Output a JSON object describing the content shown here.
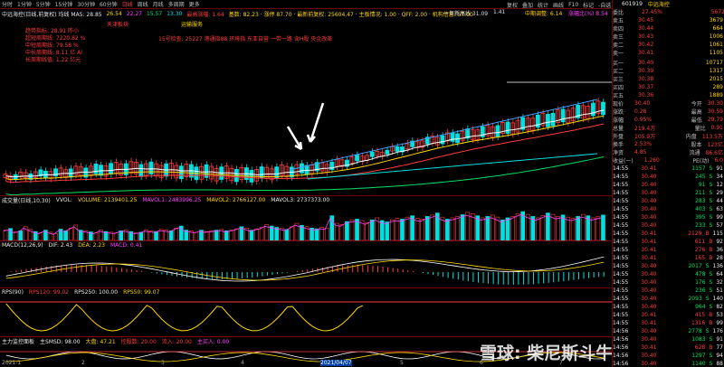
{
  "toolbar": {
    "periods": [
      "分时",
      "1分钟",
      "5分钟",
      "15分钟",
      "30分钟",
      "60分钟",
      "日线",
      "周线",
      "月线",
      "多周期",
      "更多"
    ],
    "selected": "日线",
    "right_items": [
      "复权",
      "叠加",
      "统计",
      "画线",
      "F10",
      "标记",
      "-自选",
      "返回"
    ],
    "stock_code": "601919",
    "stock_name": "中远海控"
  },
  "infoline": {
    "left": "中远海控(日线,前复权) 均线 MA5: 28.85",
    "ma10": "26.54",
    "ma20": "22.27",
    "ma30": "15.57",
    "ma60": "13.30",
    "pe_label": "最高涨幅: 1.64",
    "extra": "基数: 82.23 · 涨停 87.70 · 最新前复权: 25604.47 · 主板情况: 1.00 · QFF: 2.00 · 机构信息: 57.00",
    "anno_top": "一年新高线 31.09",
    "anno_val": "1.41",
    "anno_mid": "中期调整: 6.14",
    "anno_pct": "涨幅比(%) 8.54"
  },
  "chart_labels": {
    "label_a": "天津板块",
    "label_b": "运输服务",
    "legend_lines": [
      "趋势指标: 28.91 昨小",
      "超短周期线: 7220.82 %",
      "中短周期线: 79.58 %",
      "中长周期线: 8.11 亿 Al",
      "长周期线值: 1.22 亿元"
    ],
    "event_text": "15号检查: 25227 港通指88 环境指 东亚自营 一带一路 含H股 央企改革",
    "price_high": "31.09",
    "price_low": "6.59",
    "price_hi2": "22.95",
    "price_hi3": "6.143"
  },
  "price_axis": [
    "30.00",
    "28.00",
    "26.00",
    "24.00",
    "22.00",
    "20.00",
    "18.00",
    "16.00",
    "14.00",
    "12.00",
    "10.00"
  ],
  "volume_panel": {
    "title": "成交量(日线,10,30)",
    "vvol": "VVOL: ",
    "volume": "VOLUME: 2139401.25",
    "mavol1": "MAVOL1: 2483996.25",
    "mavol2": "MAVOL2: 2766127.00",
    "mavol3": "MAVOL3: 2737373.00",
    "axis": [
      "60000",
      "40000",
      "20000"
    ],
    "values": [
      0.3,
      0.35,
      0.25,
      0.28,
      0.4,
      0.32,
      0.26,
      0.22,
      0.3,
      0.24,
      0.2,
      0.33,
      0.28,
      0.36,
      0.45,
      0.3,
      0.28,
      0.25,
      0.22,
      0.3,
      0.26,
      0.24,
      0.22,
      0.28,
      0.3,
      0.26,
      0.22,
      0.24,
      0.3,
      0.28,
      0.26,
      0.32,
      0.3,
      0.28,
      0.36,
      0.42,
      0.3,
      0.28,
      0.24,
      0.3,
      0.26,
      0.28,
      0.3,
      0.32,
      0.28,
      0.3,
      0.34,
      0.4,
      0.36,
      0.3,
      0.34,
      0.38,
      0.46,
      0.42,
      0.38,
      0.36,
      0.32,
      0.4,
      0.5,
      0.44,
      0.4,
      0.36,
      0.34,
      0.38,
      0.36,
      0.72,
      0.5,
      0.46,
      0.55,
      0.6,
      0.62,
      0.58,
      0.52,
      0.6,
      0.66,
      0.58,
      0.54,
      0.6,
      0.64,
      0.62,
      0.68,
      0.72,
      0.65,
      0.62,
      0.7,
      0.74,
      0.8,
      0.68,
      0.62,
      0.66,
      0.7,
      0.75,
      0.82,
      0.78,
      0.72,
      0.66,
      0.7,
      0.74,
      0.68,
      0.6,
      0.66,
      0.7,
      0.78,
      0.84,
      0.76,
      0.7,
      0.66,
      0.72,
      0.8,
      0.76,
      0.7,
      0.74,
      0.68,
      0.64,
      0.7,
      0.76,
      0.72,
      0.66,
      0.7,
      0.74
    ],
    "colors": "rgrgrrgrgrrggrrgrgrrgrrgrgrgrrgrrgrggrrgrrgrgrrgrgrrrggrgrrgrggrrgrrgrgrrgrggrrgrgrrgrgrgrrgrrgrgrrggrrgrgrrgrrgr"
  },
  "macd_panel": {
    "title": "MACD(12,26,9)",
    "dif": "DIF: 2.43",
    "dea": "DEA: 2.23",
    "macd": "MACD: 0.41",
    "axis": [
      "2.00",
      "1.00",
      "0.00"
    ]
  },
  "rps_panel": {
    "title": "RPS(90)",
    "rps120": "RPS120: 99.02",
    "rps250": "RPS250: 100.00",
    "rps50": "RPS50: 99.07",
    "axis": [
      "90.00",
      "60.00",
      "30.00"
    ]
  },
  "bottom_panel": {
    "title": "主力监控面板",
    "smsd": "主SMSD: 98.00",
    "main_buy": "大盘: 47.21",
    "control": "控股数: 20.00",
    "inflow": "流入: 20.00",
    "buy": "主买入: 0.00",
    "axis": [
      "80.00",
      "40.00"
    ]
  },
  "date_axis": [
    "2021-1",
    "2",
    "3",
    "4",
    "2021/04/07",
    "5",
    "6",
    "7"
  ],
  "right_panel": {
    "code": "601919",
    "name": "中远海控",
    "ratio_label": "委比",
    "ratio": "27.45%",
    "diff_label": "委差",
    "diff": "5672",
    "sell": [
      {
        "label": "卖五",
        "price": "30.45",
        "vol": "3679"
      },
      {
        "label": "卖四",
        "price": "30.44",
        "vol": "664"
      },
      {
        "label": "卖三",
        "price": "30.43",
        "vol": "1006"
      },
      {
        "label": "卖二",
        "price": "30.42",
        "vol": "1061"
      },
      {
        "label": "卖一",
        "price": "30.41",
        "vol": "1105"
      }
    ],
    "buy": [
      {
        "label": "买一",
        "price": "30.40",
        "vol": "10717"
      },
      {
        "label": "买二",
        "price": "30.39",
        "vol": "1317"
      },
      {
        "label": "买三",
        "price": "30.38",
        "vol": "2015"
      },
      {
        "label": "买四",
        "price": "30.37",
        "vol": "289"
      },
      {
        "label": "买五",
        "price": "30.36",
        "vol": "1889"
      }
    ],
    "stats": [
      {
        "l1": "现价",
        "v1": "30.40",
        "l2": "今开",
        "v2": "30.30"
      },
      {
        "l1": "涨跌",
        "v1": "0.28",
        "l2": "最高",
        "v2": "30.59"
      },
      {
        "l1": "涨幅",
        "v1": "0.95%",
        "l2": "最低",
        "v2": "29.79"
      },
      {
        "l1": "总量",
        "v1": "219.4万",
        "l2": "量比",
        "v2": "0.91"
      },
      {
        "l1": "外盘",
        "v1": "105.9万",
        "l2": "内盘",
        "v2": "113.5万"
      },
      {
        "l1": "换手",
        "v1": "2.53%",
        "l2": "股本",
        "v2": "123亿"
      },
      {
        "l1": "净资",
        "v1": "4.85",
        "l2": "流通",
        "v2": "86.6亿"
      },
      {
        "l1": "收益(一)",
        "v1": "1.260",
        "l2": "PE(动)",
        "v2": "6.0"
      }
    ],
    "ticks": [
      {
        "t": "14:55",
        "p": "30.41",
        "v": "1157",
        "s": "S",
        "n": "91"
      },
      {
        "t": "14:55",
        "p": "30.40",
        "v": "245",
        "s": "S",
        "n": "34"
      },
      {
        "t": "14:55",
        "p": "30.40",
        "v": "91",
        "s": "S",
        "n": "12"
      },
      {
        "t": "14:55",
        "p": "30.40",
        "v": "211",
        "s": "S",
        "n": "29"
      },
      {
        "t": "14:55",
        "p": "30.40",
        "v": "283",
        "s": "S",
        "n": "44"
      },
      {
        "t": "14:55",
        "p": "30.40",
        "v": "403",
        "s": "S",
        "n": "63"
      },
      {
        "t": "14:55",
        "p": "30.40",
        "v": "395",
        "s": "S",
        "n": "99"
      },
      {
        "t": "14:55",
        "p": "30.40",
        "v": "233",
        "s": "S",
        "n": "57"
      },
      {
        "t": "14:55",
        "p": "30.41",
        "v": "2129",
        "s": "B",
        "n": "115"
      },
      {
        "t": "14:55",
        "p": "30.41",
        "v": "611",
        "s": "B",
        "n": "92"
      },
      {
        "t": "14:55",
        "p": "30.41",
        "v": "276",
        "s": "B",
        "n": "36"
      },
      {
        "t": "14:55",
        "p": "30.41",
        "v": "165",
        "s": "B",
        "n": "28"
      },
      {
        "t": "14:55",
        "p": "30.40",
        "v": "2017",
        "s": "S",
        "n": "136"
      },
      {
        "t": "14:55",
        "p": "30.40",
        "v": "478",
        "s": "S",
        "n": "64"
      },
      {
        "t": "14:55",
        "p": "30.40",
        "v": "176",
        "s": "S",
        "n": "32"
      },
      {
        "t": "14:55",
        "p": "30.40",
        "v": "236",
        "s": "S",
        "n": "51"
      },
      {
        "t": "14:55",
        "p": "30.40",
        "v": "2093",
        "s": "S",
        "n": "140"
      },
      {
        "t": "14:55",
        "p": "30.40",
        "v": "964",
        "s": "S",
        "n": "82"
      },
      {
        "t": "14:55",
        "p": "30.41",
        "v": "415",
        "s": "B",
        "n": "53"
      },
      {
        "t": "14:55",
        "p": "30.41",
        "v": "1316",
        "s": "B",
        "n": "99"
      },
      {
        "t": "14:56",
        "p": "30.40",
        "v": "2778",
        "s": "S",
        "n": "176"
      },
      {
        "t": "14:56",
        "p": "30.40",
        "v": "1083",
        "s": "S",
        "n": "91"
      },
      {
        "t": "14:56",
        "p": "30.41",
        "v": "628",
        "s": "B",
        "n": "77"
      },
      {
        "t": "14:56",
        "p": "30.40",
        "v": "1297",
        "s": "S",
        "n": "94"
      },
      {
        "t": "14:56",
        "p": "30.40",
        "v": "1140",
        "s": "S",
        "n": "88"
      },
      {
        "t": "14:57",
        "p": "30.40",
        "v": "138",
        "s": "S",
        "n": "20"
      },
      {
        "t": "14:57",
        "p": "30.40",
        "v": "133",
        "s": "S",
        "n": "19"
      },
      {
        "t": "14:57",
        "p": "30.40",
        "v": "85",
        "s": "S",
        "n": "11"
      }
    ]
  },
  "watermark": "雪球: 柴尼斯斗牛仕",
  "colors": {
    "up": "#ff3b3b",
    "down": "#00e0e0",
    "ma5": "#ffffff",
    "ma10": "#ffd700",
    "ma20": "#ff40ff",
    "ma30": "#00e060",
    "separator": "#770000"
  }
}
